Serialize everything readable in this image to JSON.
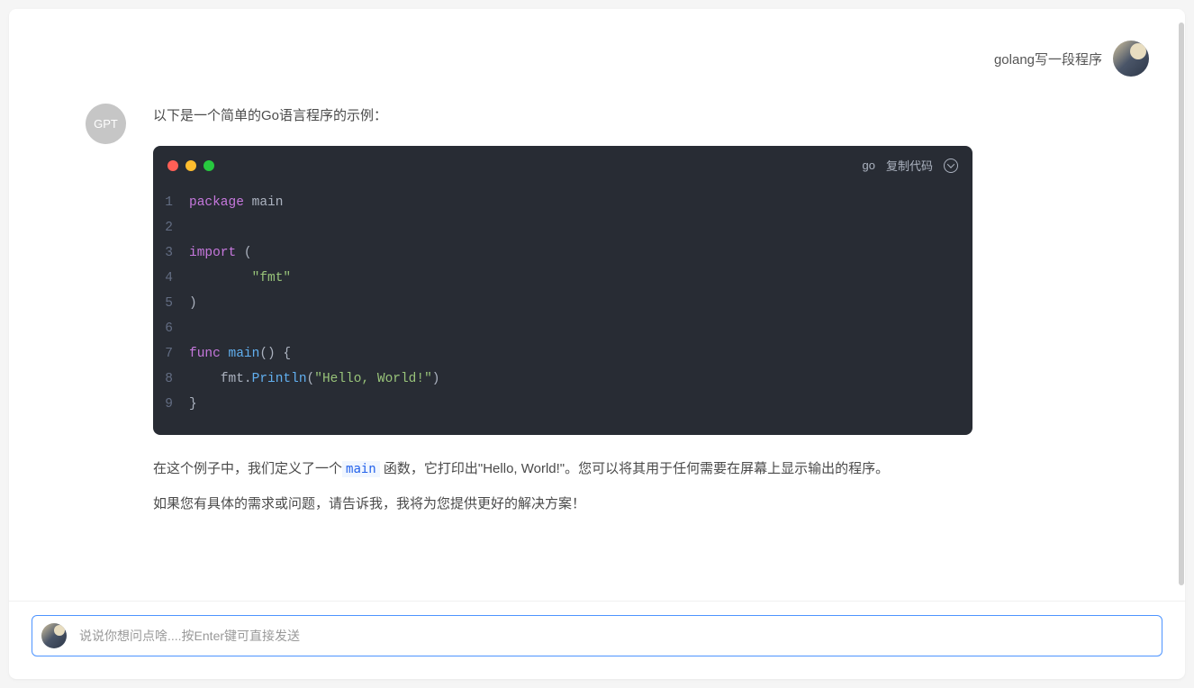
{
  "user": {
    "message": "golang写一段程序"
  },
  "bot": {
    "avatar_label": "GPT",
    "intro_text": "以下是一个简单的Go语言程序的示例：",
    "explanation_before": "在这个例子中，我们定义了一个",
    "explanation_inline": "main",
    "explanation_after": " 函数，它打印出\"Hello, World!\"。您可以将其用于任何需要在屏幕上显示输出的程序。",
    "followup": "如果您有具体的需求或问题，请告诉我，我将为您提供更好的解决方案！"
  },
  "code": {
    "language": "go",
    "copy_label": "复制代码",
    "lines": [
      {
        "n": "1",
        "tokens": [
          {
            "c": "kw",
            "t": "package"
          },
          {
            "c": "pln",
            "t": " "
          },
          {
            "c": "pln",
            "t": "main"
          }
        ]
      },
      {
        "n": "2",
        "tokens": []
      },
      {
        "n": "3",
        "tokens": [
          {
            "c": "kw",
            "t": "import"
          },
          {
            "c": "pln",
            "t": " ("
          }
        ]
      },
      {
        "n": "4",
        "tokens": [
          {
            "c": "pln",
            "t": "        "
          },
          {
            "c": "str",
            "t": "\"fmt\""
          }
        ]
      },
      {
        "n": "5",
        "tokens": [
          {
            "c": "pln",
            "t": ")"
          }
        ]
      },
      {
        "n": "6",
        "tokens": []
      },
      {
        "n": "7",
        "tokens": [
          {
            "c": "kw",
            "t": "func"
          },
          {
            "c": "pln",
            "t": " "
          },
          {
            "c": "fn",
            "t": "main"
          },
          {
            "c": "pln",
            "t": "() {"
          }
        ]
      },
      {
        "n": "8",
        "tokens": [
          {
            "c": "pln",
            "t": "    fmt."
          },
          {
            "c": "fn",
            "t": "Println"
          },
          {
            "c": "pln",
            "t": "("
          },
          {
            "c": "str",
            "t": "\"Hello, World!\""
          },
          {
            "c": "pln",
            "t": ")"
          }
        ]
      },
      {
        "n": "9",
        "tokens": [
          {
            "c": "pln",
            "t": "}"
          }
        ]
      }
    ]
  },
  "input": {
    "placeholder": "说说你想问点啥....按Enter键可直接发送"
  }
}
